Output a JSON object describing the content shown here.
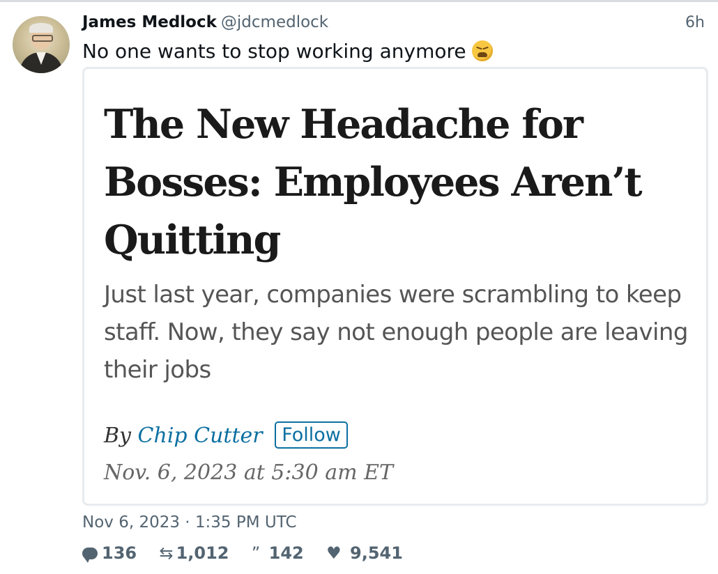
{
  "tweet": {
    "author_name": "James Medlock",
    "author_handle": "@jdcmedlock",
    "relative_time": "6h",
    "text": "No one wants to stop working anymore",
    "emoji": "weary-face-emoji",
    "timestamp": "Nov 6, 2023 · 1:35 PM UTC",
    "stats": {
      "replies": "136",
      "retweets": "1,012",
      "quotes": "142",
      "likes": "9,541"
    }
  },
  "article_card": {
    "headline": "The New Headache for Bosses: Employees Aren’t Quitting",
    "dek": "Just last year, companies were scrambling to keep staff. Now, they say not enough people are leaving their jobs",
    "byline_prefix": "By",
    "author": "Chip Cutter",
    "follow_label": "Follow",
    "date": "Nov. 6, 2023 at 5:30 am ET"
  },
  "icons": {
    "reply": "comment-icon",
    "retweet": "retweet-icon",
    "quote": "quote-icon",
    "like": "heart-icon"
  },
  "colors": {
    "link_blue": "#0b6fa1",
    "muted_text": "#536471"
  }
}
